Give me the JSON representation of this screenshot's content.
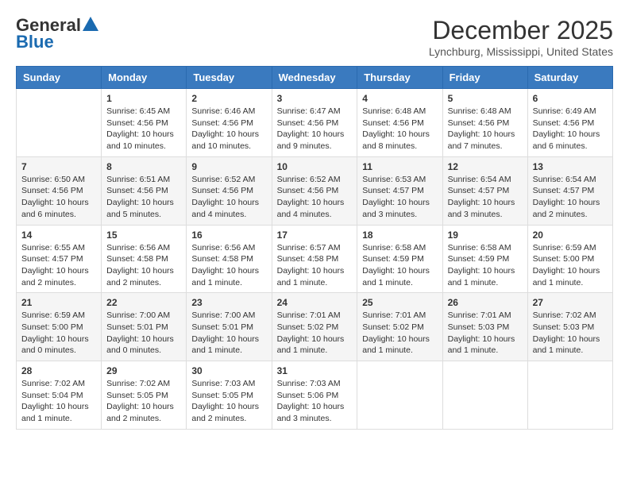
{
  "header": {
    "logo_line1": "General",
    "logo_line2": "Blue",
    "month_title": "December 2025",
    "location": "Lynchburg, Mississippi, United States"
  },
  "weekdays": [
    "Sunday",
    "Monday",
    "Tuesday",
    "Wednesday",
    "Thursday",
    "Friday",
    "Saturday"
  ],
  "weeks": [
    [
      {
        "day": "",
        "info": ""
      },
      {
        "day": "1",
        "info": "Sunrise: 6:45 AM\nSunset: 4:56 PM\nDaylight: 10 hours\nand 10 minutes."
      },
      {
        "day": "2",
        "info": "Sunrise: 6:46 AM\nSunset: 4:56 PM\nDaylight: 10 hours\nand 10 minutes."
      },
      {
        "day": "3",
        "info": "Sunrise: 6:47 AM\nSunset: 4:56 PM\nDaylight: 10 hours\nand 9 minutes."
      },
      {
        "day": "4",
        "info": "Sunrise: 6:48 AM\nSunset: 4:56 PM\nDaylight: 10 hours\nand 8 minutes."
      },
      {
        "day": "5",
        "info": "Sunrise: 6:48 AM\nSunset: 4:56 PM\nDaylight: 10 hours\nand 7 minutes."
      },
      {
        "day": "6",
        "info": "Sunrise: 6:49 AM\nSunset: 4:56 PM\nDaylight: 10 hours\nand 6 minutes."
      }
    ],
    [
      {
        "day": "7",
        "info": "Sunrise: 6:50 AM\nSunset: 4:56 PM\nDaylight: 10 hours\nand 6 minutes."
      },
      {
        "day": "8",
        "info": "Sunrise: 6:51 AM\nSunset: 4:56 PM\nDaylight: 10 hours\nand 5 minutes."
      },
      {
        "day": "9",
        "info": "Sunrise: 6:52 AM\nSunset: 4:56 PM\nDaylight: 10 hours\nand 4 minutes."
      },
      {
        "day": "10",
        "info": "Sunrise: 6:52 AM\nSunset: 4:56 PM\nDaylight: 10 hours\nand 4 minutes."
      },
      {
        "day": "11",
        "info": "Sunrise: 6:53 AM\nSunset: 4:57 PM\nDaylight: 10 hours\nand 3 minutes."
      },
      {
        "day": "12",
        "info": "Sunrise: 6:54 AM\nSunset: 4:57 PM\nDaylight: 10 hours\nand 3 minutes."
      },
      {
        "day": "13",
        "info": "Sunrise: 6:54 AM\nSunset: 4:57 PM\nDaylight: 10 hours\nand 2 minutes."
      }
    ],
    [
      {
        "day": "14",
        "info": "Sunrise: 6:55 AM\nSunset: 4:57 PM\nDaylight: 10 hours\nand 2 minutes."
      },
      {
        "day": "15",
        "info": "Sunrise: 6:56 AM\nSunset: 4:58 PM\nDaylight: 10 hours\nand 2 minutes."
      },
      {
        "day": "16",
        "info": "Sunrise: 6:56 AM\nSunset: 4:58 PM\nDaylight: 10 hours\nand 1 minute."
      },
      {
        "day": "17",
        "info": "Sunrise: 6:57 AM\nSunset: 4:58 PM\nDaylight: 10 hours\nand 1 minute."
      },
      {
        "day": "18",
        "info": "Sunrise: 6:58 AM\nSunset: 4:59 PM\nDaylight: 10 hours\nand 1 minute."
      },
      {
        "day": "19",
        "info": "Sunrise: 6:58 AM\nSunset: 4:59 PM\nDaylight: 10 hours\nand 1 minute."
      },
      {
        "day": "20",
        "info": "Sunrise: 6:59 AM\nSunset: 5:00 PM\nDaylight: 10 hours\nand 1 minute."
      }
    ],
    [
      {
        "day": "21",
        "info": "Sunrise: 6:59 AM\nSunset: 5:00 PM\nDaylight: 10 hours\nand 0 minutes."
      },
      {
        "day": "22",
        "info": "Sunrise: 7:00 AM\nSunset: 5:01 PM\nDaylight: 10 hours\nand 0 minutes."
      },
      {
        "day": "23",
        "info": "Sunrise: 7:00 AM\nSunset: 5:01 PM\nDaylight: 10 hours\nand 1 minute."
      },
      {
        "day": "24",
        "info": "Sunrise: 7:01 AM\nSunset: 5:02 PM\nDaylight: 10 hours\nand 1 minute."
      },
      {
        "day": "25",
        "info": "Sunrise: 7:01 AM\nSunset: 5:02 PM\nDaylight: 10 hours\nand 1 minute."
      },
      {
        "day": "26",
        "info": "Sunrise: 7:01 AM\nSunset: 5:03 PM\nDaylight: 10 hours\nand 1 minute."
      },
      {
        "day": "27",
        "info": "Sunrise: 7:02 AM\nSunset: 5:03 PM\nDaylight: 10 hours\nand 1 minute."
      }
    ],
    [
      {
        "day": "28",
        "info": "Sunrise: 7:02 AM\nSunset: 5:04 PM\nDaylight: 10 hours\nand 1 minute."
      },
      {
        "day": "29",
        "info": "Sunrise: 7:02 AM\nSunset: 5:05 PM\nDaylight: 10 hours\nand 2 minutes."
      },
      {
        "day": "30",
        "info": "Sunrise: 7:03 AM\nSunset: 5:05 PM\nDaylight: 10 hours\nand 2 minutes."
      },
      {
        "day": "31",
        "info": "Sunrise: 7:03 AM\nSunset: 5:06 PM\nDaylight: 10 hours\nand 3 minutes."
      },
      {
        "day": "",
        "info": ""
      },
      {
        "day": "",
        "info": ""
      },
      {
        "day": "",
        "info": ""
      }
    ]
  ]
}
